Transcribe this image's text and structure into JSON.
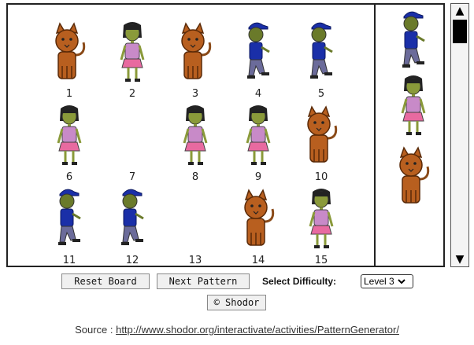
{
  "board": {
    "cells": [
      {
        "number": "1",
        "figure": "cat"
      },
      {
        "number": "2",
        "figure": "girl"
      },
      {
        "number": "3",
        "figure": "cat"
      },
      {
        "number": "4",
        "figure": "boy"
      },
      {
        "number": "5",
        "figure": "boy"
      },
      {
        "number": "6",
        "figure": "girl"
      },
      {
        "number": "7",
        "figure": "empty"
      },
      {
        "number": "8",
        "figure": "girl"
      },
      {
        "number": "9",
        "figure": "girl"
      },
      {
        "number": "10",
        "figure": "cat"
      },
      {
        "number": "11",
        "figure": "boy"
      },
      {
        "number": "12",
        "figure": "boy"
      },
      {
        "number": "13",
        "figure": "empty"
      },
      {
        "number": "14",
        "figure": "cat"
      },
      {
        "number": "15",
        "figure": "girl"
      }
    ]
  },
  "palette": {
    "items": [
      {
        "figure": "boy"
      },
      {
        "figure": "girl"
      },
      {
        "figure": "cat"
      }
    ]
  },
  "controls": {
    "reset_label": "Reset Board",
    "next_label": "Next Pattern",
    "difficulty_label": "Select Difficulty:",
    "difficulty_value": "Level 3",
    "shodor_label": "© Shodor"
  },
  "source": {
    "prefix": "Source : ",
    "link": "http://www.shodor.org/interactivate/activities/PatternGenerator/"
  },
  "icons": {
    "scroll_up": "scroll-up-icon",
    "scroll_down": "scroll-down-icon",
    "select_arrow": "chevron-down-icon"
  }
}
